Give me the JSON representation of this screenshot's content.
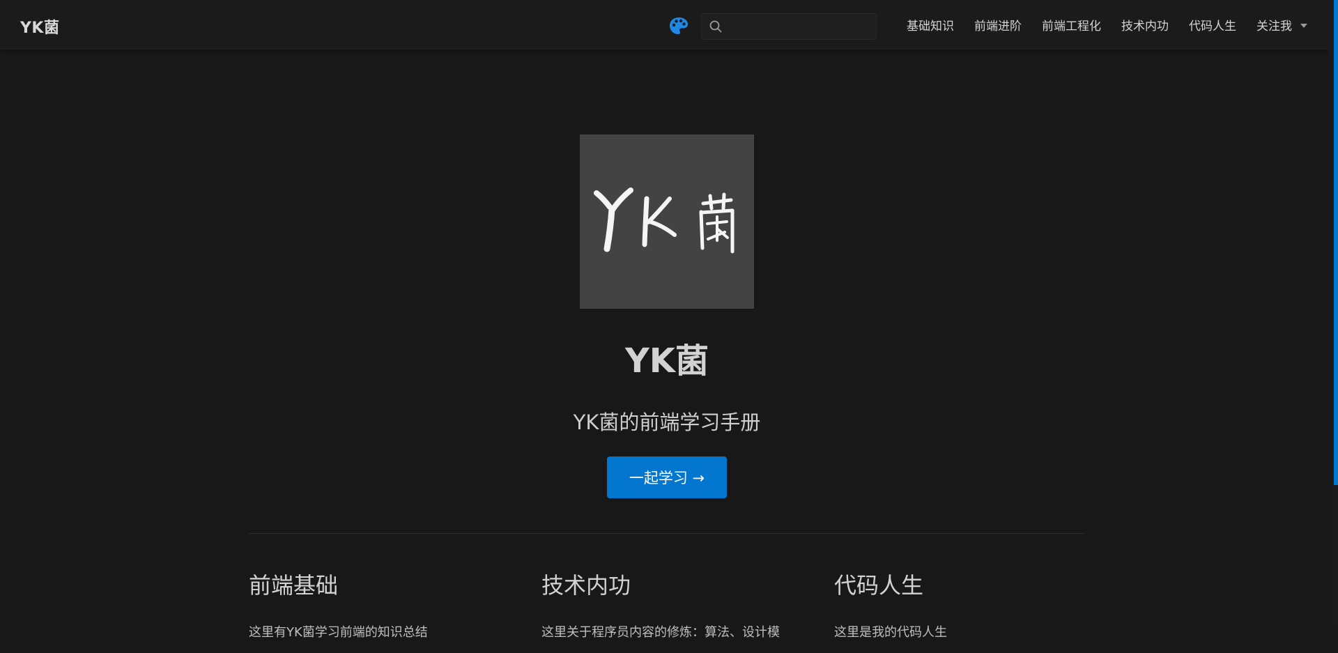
{
  "navbar": {
    "site_name": "YK菌",
    "search": {
      "placeholder": "",
      "value": ""
    },
    "links": [
      "基础知识",
      "前端进阶",
      "前端工程化",
      "技术内功",
      "代码人生"
    ],
    "dropdown_label": "关注我",
    "accent_color": "#0376d0"
  },
  "hero": {
    "image_text": "YK菌",
    "title": "YK菌",
    "description": "YK菌的前端学习手册",
    "action_text": "一起学习 →"
  },
  "features": [
    {
      "title": "前端基础",
      "details": "这里有YK菌学习前端的知识总结"
    },
    {
      "title": "技术内功",
      "details": "这里关于程序员内容的修炼：算法、设计模"
    },
    {
      "title": "代码人生",
      "details": "这里是我的代码人生"
    }
  ]
}
